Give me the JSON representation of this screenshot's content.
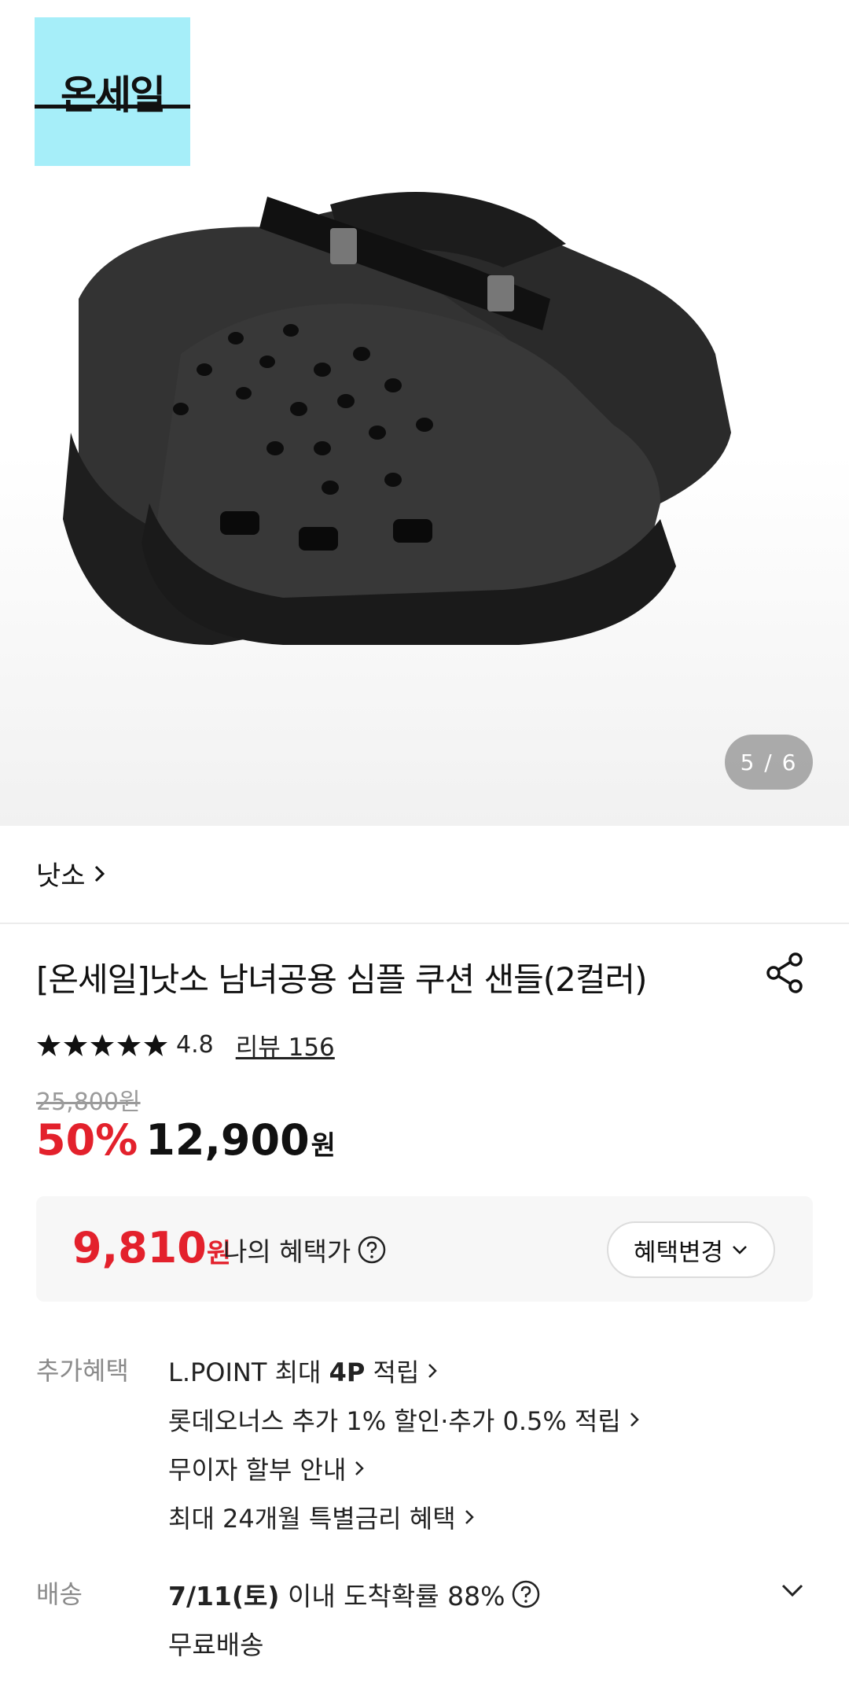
{
  "hero": {
    "logo_text": "온세일",
    "image_counter": "5 / 6"
  },
  "brand": {
    "name": "낫소"
  },
  "product": {
    "title": "[온세일]낫소 남녀공용 심플 쿠션 샌들(2컬러)",
    "rating": "4.8",
    "stars": 5,
    "review_label": "리뷰 156",
    "original_price": "25,800원",
    "discount": "50%",
    "price": "12,900",
    "price_unit": "원"
  },
  "benefit_box": {
    "price": "9,810",
    "unit": "원",
    "label": "나의 혜택가",
    "button_label": "혜택변경"
  },
  "extra_benefits": {
    "label": "추가혜택",
    "items": [
      {
        "prefix": "L.POINT 최대 ",
        "bold": "4P",
        "suffix": " 적립"
      },
      {
        "prefix": "롯데오너스 추가 1% 할인·추가 0.5% 적립",
        "bold": "",
        "suffix": ""
      },
      {
        "prefix": "무이자 할부 안내",
        "bold": "",
        "suffix": ""
      },
      {
        "prefix": "최대 24개월 특별금리 혜택",
        "bold": "",
        "suffix": ""
      }
    ]
  },
  "delivery": {
    "label": "배송",
    "date": "7/11(토)",
    "text": " 이내 도착확률 88%",
    "free_shipping": "무료배송"
  },
  "colors": {
    "accent_red": "#e3212c",
    "logo_bg": "#a6eef9"
  }
}
